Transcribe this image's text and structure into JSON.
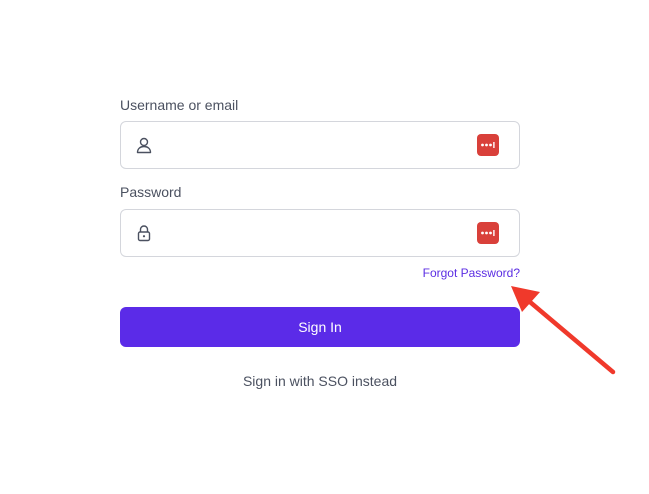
{
  "username": {
    "label": "Username or email",
    "value": "",
    "placeholder": ""
  },
  "password": {
    "label": "Password",
    "value": "",
    "placeholder": ""
  },
  "forgot_password": "Forgot Password?",
  "sign_in_button": "Sign In",
  "sso_link": "Sign in with SSO instead",
  "icons": {
    "username": "user-icon",
    "password": "lock-icon",
    "password_manager": "password-manager-icon",
    "annotation": "arrow-icon"
  },
  "colors": {
    "accent": "#5b2be8",
    "link": "#5b2de3",
    "password_manager": "#d9403a",
    "annotation_arrow": "#f0392b"
  }
}
